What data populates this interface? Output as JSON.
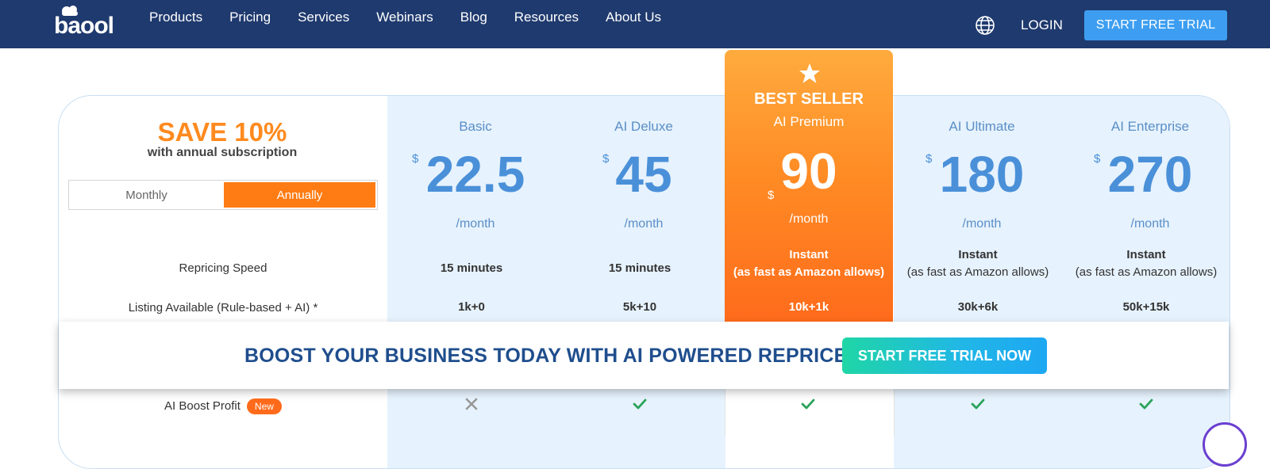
{
  "nav": {
    "logo_text": "baool",
    "links": [
      "Products",
      "Pricing",
      "Services",
      "Webinars",
      "Blog",
      "Resources",
      "About Us"
    ],
    "login": "LOGIN",
    "cta": "START FREE TRIAL",
    "globe_icon": "globe-icon"
  },
  "promo": {
    "title": "SAVE 10%",
    "subtitle": "with annual subscription"
  },
  "billing_toggle": {
    "monthly": "Monthly",
    "annually": "Annually",
    "selected": "Annually"
  },
  "plans": [
    {
      "name": "Basic",
      "currency": "$",
      "price": "22.5",
      "period": "/month",
      "speed": [
        "15 minutes"
      ],
      "listings": "1k+0",
      "ai_boost": "cross"
    },
    {
      "name": "AI Deluxe",
      "currency": "$",
      "price": "45",
      "period": "/month",
      "speed": [
        "15 minutes"
      ],
      "listings": "5k+10",
      "ai_boost": "check"
    },
    {
      "name": "AI Premium",
      "badge": "BEST SELLER",
      "currency": "$",
      "price": "90",
      "period": "/month",
      "speed": [
        "Instant",
        "(as fast as Amazon allows)"
      ],
      "listings": "10k+1k",
      "ai_boost": "check"
    },
    {
      "name": "AI Ultimate",
      "currency": "$",
      "price": "180",
      "period": "/month",
      "speed": [
        "Instant",
        "(as fast as Amazon allows)"
      ],
      "listings": "30k+6k",
      "ai_boost": "check"
    },
    {
      "name": "AI Enterprise",
      "currency": "$",
      "price": "270",
      "period": "/month",
      "speed": [
        "Instant",
        "(as fast as Amazon allows)"
      ],
      "listings": "50k+15k",
      "ai_boost": "check"
    }
  ],
  "rows": {
    "speed": "Repricing Speed",
    "listings": "Listing Available (Rule-based + AI) *",
    "ai_boost": "AI Boost Profit",
    "ai_boost_badge": "New"
  },
  "banner": {
    "text": "BOOST YOUR BUSINESS TODAY WITH AI POWERED REPRICER",
    "cta": "START FREE TRIAL NOW"
  },
  "colors": {
    "nav_bg": "#1f3a6e",
    "accent_orange": "#ff7c14",
    "price_blue": "#4a90d9",
    "column_bg": "#e6f2fd",
    "check_green": "#2aa35a",
    "cross_grey": "#999999"
  }
}
